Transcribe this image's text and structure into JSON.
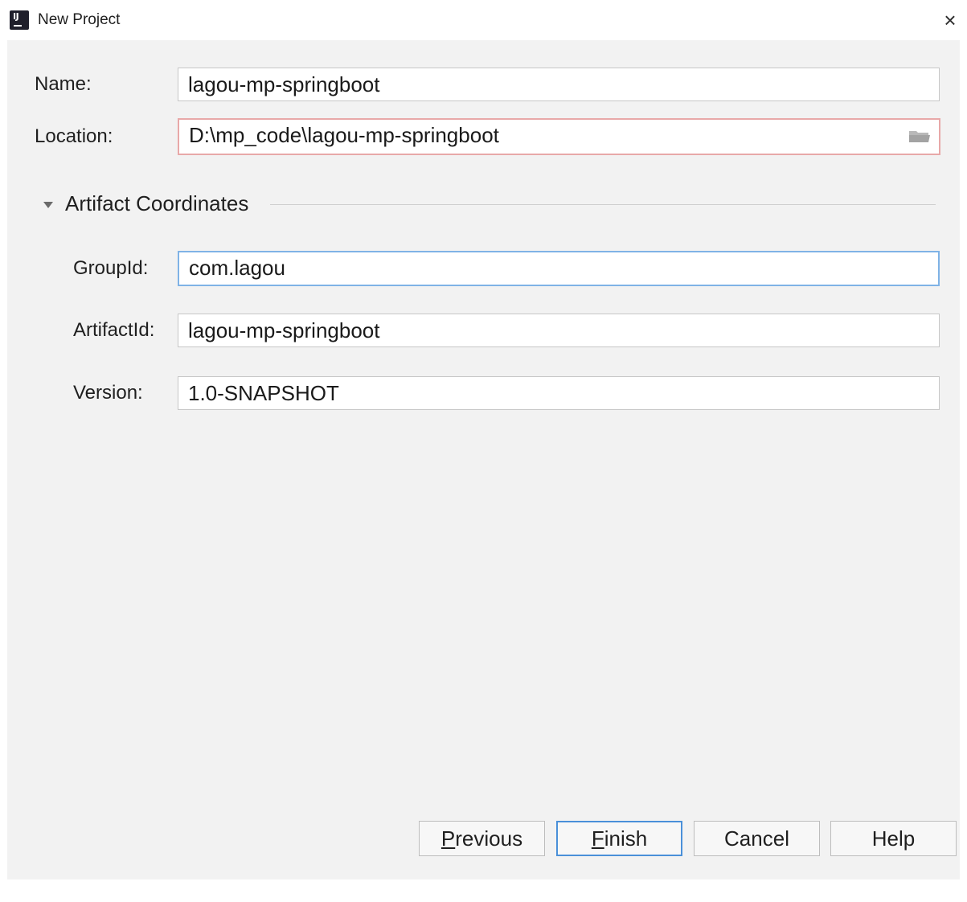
{
  "window": {
    "title": "New Project",
    "close_glyph": "×",
    "app_icon_text": "IJ"
  },
  "form": {
    "name": {
      "label": "Name:",
      "value": "lagou-mp-springboot"
    },
    "location": {
      "label": "Location:",
      "value": "D:\\mp_code\\lagou-mp-springboot",
      "state": "error"
    }
  },
  "artifact": {
    "section_title": "Artifact Coordinates",
    "expanded": true,
    "group_id": {
      "label": "GroupId:",
      "value": "com.lagou",
      "state": "focused"
    },
    "artifact_id": {
      "label": "ArtifactId:",
      "value": "lagou-mp-springboot"
    },
    "version": {
      "label": "Version:",
      "value": "1.0-SNAPSHOT"
    }
  },
  "buttons": {
    "previous": {
      "mnemonic": "P",
      "rest": "revious"
    },
    "finish": {
      "mnemonic": "F",
      "rest": "inish",
      "default": true
    },
    "cancel": {
      "label": "Cancel"
    },
    "help": {
      "label": "Help"
    }
  },
  "colors": {
    "panel_bg": "#f2f2f2",
    "error_border": "#e8a8a8",
    "focus_border": "#7fb3e6",
    "default_button_border": "#4a90d9"
  },
  "icons": {
    "app": "intellij-idea-icon",
    "close": "close-icon",
    "browse": "folder-icon",
    "section_toggle": "triangle-down-icon"
  }
}
